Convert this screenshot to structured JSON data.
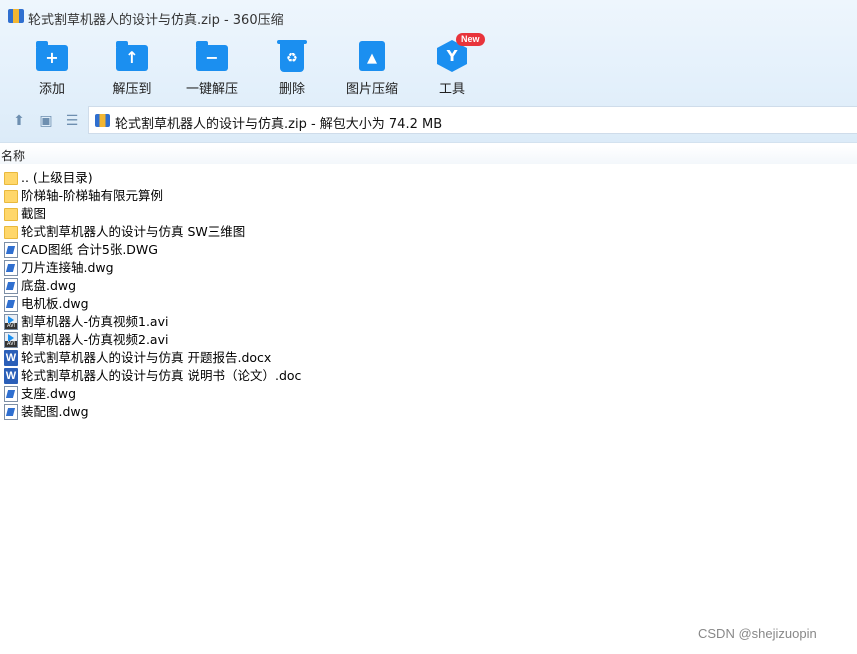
{
  "window": {
    "title": "轮式割草机器人的设计与仿真.zip - 360压缩"
  },
  "toolbar": {
    "items": [
      {
        "label": "添加",
        "icon": "add-folder-icon"
      },
      {
        "label": "解压到",
        "icon": "extract-to-icon"
      },
      {
        "label": "一键解压",
        "icon": "one-click-extract-icon"
      },
      {
        "label": "删除",
        "icon": "trash-icon"
      },
      {
        "label": "图片压缩",
        "icon": "image-compress-icon"
      },
      {
        "label": "工具",
        "icon": "tools-icon"
      }
    ],
    "badge": "New"
  },
  "navbar": {
    "path_text": "轮式割草机器人的设计与仿真.zip - 解包大小为 74.2 MB"
  },
  "list": {
    "column_name": "名称",
    "files": [
      {
        "name": ".. (上级目录)",
        "type": "folder"
      },
      {
        "name": "阶梯轴-阶梯轴有限元算例",
        "type": "folder"
      },
      {
        "name": "截图",
        "type": "folder"
      },
      {
        "name": "轮式割草机器人的设计与仿真 SW三维图",
        "type": "folder"
      },
      {
        "name": "CAD图纸 合计5张.DWG",
        "type": "dwg"
      },
      {
        "name": "刀片连接轴.dwg",
        "type": "dwg"
      },
      {
        "name": "底盘.dwg",
        "type": "dwg"
      },
      {
        "name": "电机板.dwg",
        "type": "dwg"
      },
      {
        "name": "割草机器人-仿真视频1.avi",
        "type": "avi"
      },
      {
        "name": "割草机器人-仿真视频2.avi",
        "type": "avi"
      },
      {
        "name": "轮式割草机器人的设计与仿真 开题报告.docx",
        "type": "doc"
      },
      {
        "name": "轮式割草机器人的设计与仿真 说明书（论文）.doc",
        "type": "doc"
      },
      {
        "name": "支座.dwg",
        "type": "dwg"
      },
      {
        "name": "装配图.dwg",
        "type": "dwg"
      }
    ]
  },
  "watermark": "CSDN @shejizuopin"
}
